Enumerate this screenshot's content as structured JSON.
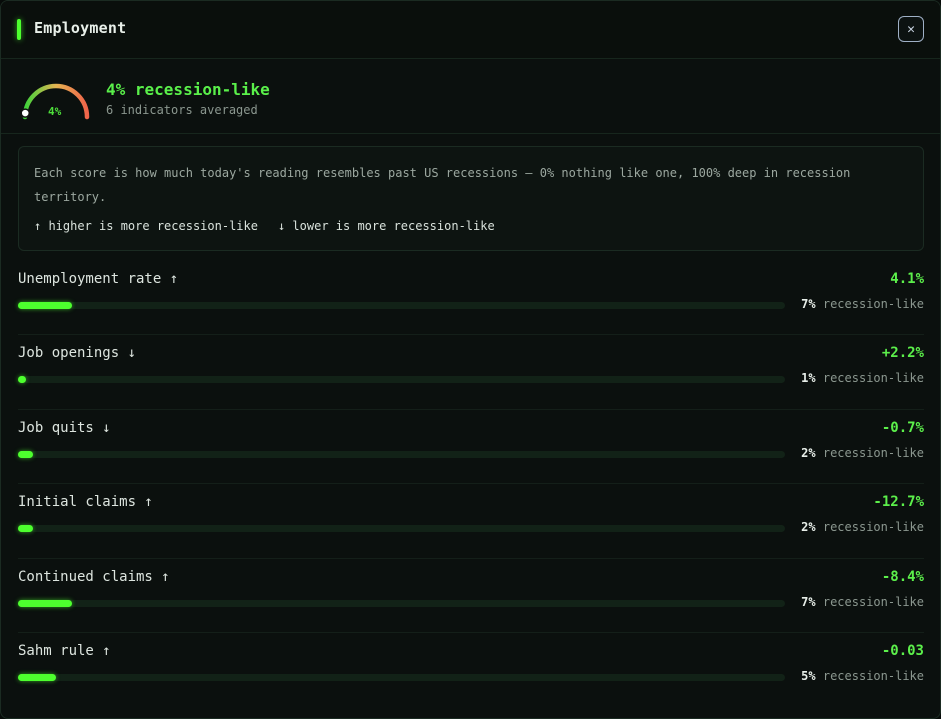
{
  "header": {
    "title": "Employment",
    "close_icon": "close-icon"
  },
  "summary": {
    "gauge_value": 4,
    "gauge_label": "4%",
    "title": "4% recession-like",
    "subtitle": "6 indicators averaged"
  },
  "info": {
    "text": "Each score is how much today's reading resembles past US recessions — 0% nothing like one, 100% deep in recession territory.",
    "legend_up": "↑ higher is more recession-like",
    "legend_down": "↓ lower is more recession-like"
  },
  "indicators": [
    {
      "label": "Unemployment rate ↑",
      "value": "4.1%",
      "score_pct": 7,
      "score": "7%",
      "suffix": "recession-like"
    },
    {
      "label": "Job openings ↓",
      "value": "+2.2%",
      "score_pct": 1,
      "score": "1%",
      "suffix": "recession-like"
    },
    {
      "label": "Job quits ↓",
      "value": "-0.7%",
      "score_pct": 2,
      "score": "2%",
      "suffix": "recession-like"
    },
    {
      "label": "Initial claims ↑",
      "value": "-12.7%",
      "score_pct": 2,
      "score": "2%",
      "suffix": "recession-like"
    },
    {
      "label": "Continued claims ↑",
      "value": "-8.4%",
      "score_pct": 7,
      "score": "7%",
      "suffix": "recession-like"
    },
    {
      "label": "Sahm rule ↑",
      "value": "-0.03",
      "score_pct": 5,
      "score": "5%",
      "suffix": "recession-like"
    }
  ],
  "colors": {
    "accent": "#4dff2e",
    "value_green": "#5cf04b",
    "background": "#0b100e"
  }
}
